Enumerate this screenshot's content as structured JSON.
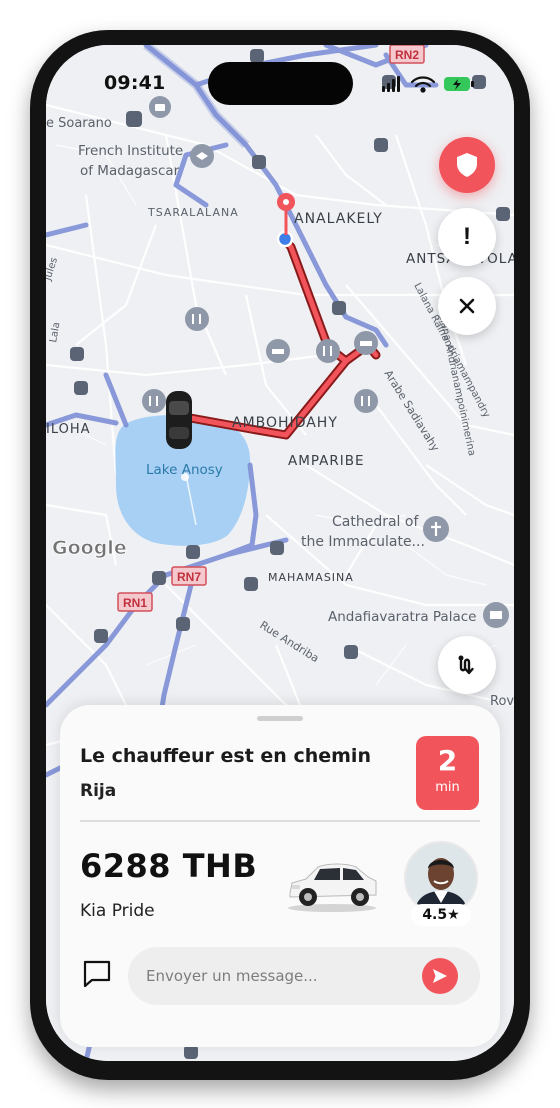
{
  "status_bar": {
    "time": "09:41"
  },
  "map": {
    "labels": {
      "soarano": "e Soarano",
      "french_institute_1": "French Institute",
      "french_institute_2": "of Madagascar",
      "tsaralalana": "TSARALALANA",
      "analakely": "ANALAKELY",
      "antsahavola": "ANTSAHAVOLA",
      "ambohidahy": "AMBOHIDAHY",
      "amparibe": "AMPARIBE",
      "lake": "Lake Anosy",
      "iloha": "ILOHA",
      "cathedral_1": "Cathedral of",
      "cathedral_2": "the Immaculate...",
      "mahamasina": "MAHAMASINA",
      "andafiavaratra": "Andafiavaratra Palace",
      "google": "Google",
      "rue_andriba": "Rue Andriba",
      "arabe_sadiavahy": "Arabe Sadiavahy",
      "lalana_rainandriamampandry": "Lalana Rainandriamampandry",
      "lalana_andrianampoinimerina": "Lalana Andrianampoinimerina",
      "jules": "Jules",
      "rue_lala": "Lala",
      "boulevard": "Rov"
    },
    "road_badges": {
      "rn2": "RN2",
      "rn7": "RN7",
      "rn1": "RN1"
    },
    "route_color": "#f2545b",
    "buttons": {
      "shield_icon": "shield-icon",
      "alert_label": "!",
      "close_icon": "close-icon",
      "route_icon": "route-icon"
    }
  },
  "trip": {
    "status_title": "Le chauffeur est en chemin",
    "driver_name": "Rija",
    "eta_value": "2",
    "eta_unit": "min",
    "fare": "6288 THB",
    "car_model": "Kia Pride",
    "rating": "4.5★"
  },
  "message": {
    "placeholder": "Envoyer un message...",
    "send_icon": "send-icon",
    "chat_icon": "chat-bubble-icon"
  },
  "colors": {
    "accent": "#f2545b",
    "map_background": "#eef0f3",
    "major_road": "#7e8fd6",
    "water": "#a8d0f5"
  }
}
